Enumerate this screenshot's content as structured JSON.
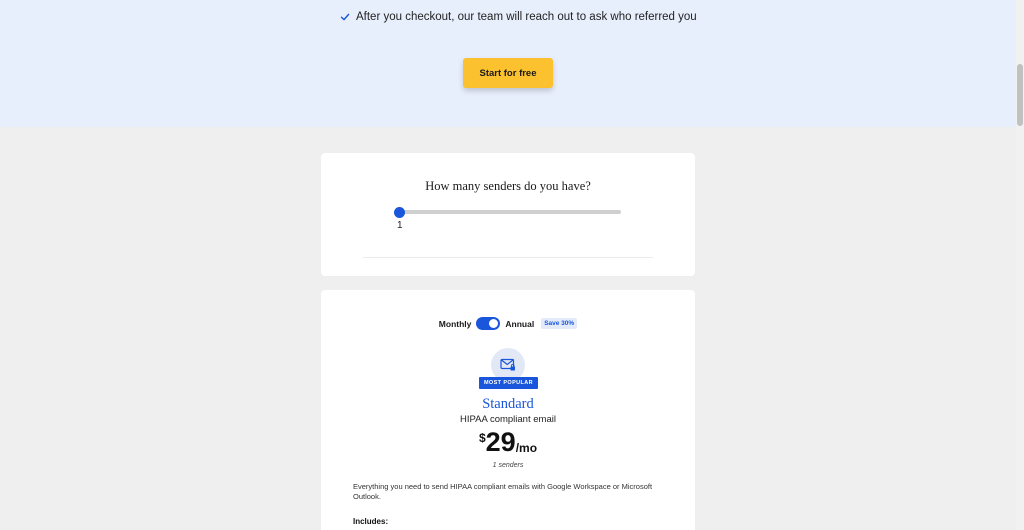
{
  "hero": {
    "check_text": "After you checkout, our team will reach out to ask who referred you",
    "cta_label": "Start for free"
  },
  "senders": {
    "question": "How many senders do you have?",
    "value": "1",
    "slider_fraction": 0
  },
  "pricing": {
    "billing_monthly": "Monthly",
    "billing_annual": "Annual",
    "save_badge": "Save 30%",
    "toggle_on": true,
    "popular_badge": "MOST POPULAR",
    "plan_name": "Standard",
    "plan_subtitle": "HIPAA compliant email",
    "currency": "$",
    "price": "29",
    "period": "/mo",
    "price_note": "1 senders",
    "description": "Everything you need to send HIPAA compliant emails with Google Workspace or Microsoft Outlook.",
    "includes_label": "Includes:",
    "icon": "envelope-lock-icon"
  },
  "colors": {
    "accent": "#1a56db",
    "cta": "#fcc12e",
    "hero_bg": "#e8effc",
    "page_bg": "#efefef"
  }
}
